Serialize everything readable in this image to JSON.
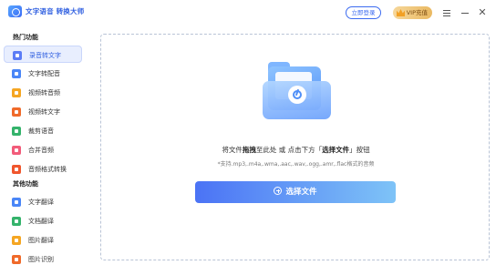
{
  "app": {
    "title": "文字语音 转换大师"
  },
  "header": {
    "login_label": "立即登录",
    "vip_label": "VIP充值",
    "icons": [
      "menu-icon",
      "minimize-icon",
      "close-icon"
    ],
    "close_glyph": "✕"
  },
  "sidebar": {
    "hot_section": "热门功能",
    "hot_items": [
      {
        "label": "录音转文字",
        "icon": "record-to-text-icon",
        "color": "#5b7cf6",
        "active": true
      },
      {
        "label": "文字转配音",
        "icon": "text-to-voice-icon",
        "color": "#4a86f7",
        "active": false
      },
      {
        "label": "视频转音频",
        "icon": "video-to-audio-icon",
        "color": "#f5a623",
        "active": false
      },
      {
        "label": "视频转文字",
        "icon": "video-to-text-icon",
        "color": "#f06a2a",
        "active": false
      },
      {
        "label": "裁剪语音",
        "icon": "crop-audio-icon",
        "color": "#34b36b",
        "active": false
      },
      {
        "label": "合并音频",
        "icon": "merge-audio-icon",
        "color": "#f25c7a",
        "active": false
      },
      {
        "label": "音频格式转换",
        "icon": "audio-convert-icon",
        "color": "#f0562d",
        "active": false
      }
    ],
    "other_section": "其他功能",
    "other_items": [
      {
        "label": "文字翻译",
        "icon": "text-translate-icon",
        "color": "#4a86f7",
        "active": false
      },
      {
        "label": "文档翻译",
        "icon": "doc-translate-icon",
        "color": "#34b36b",
        "active": false
      },
      {
        "label": "图片翻译",
        "icon": "image-translate-icon",
        "color": "#f5a623",
        "active": false
      },
      {
        "label": "图片识别",
        "icon": "image-ocr-icon",
        "color": "#f06a2a",
        "active": false
      }
    ]
  },
  "main": {
    "hint_part1": "将文件",
    "hint_bold1": "拖拽",
    "hint_part2": "至此处 或 点击下方「",
    "hint_bold2": "选择文件",
    "hint_part3": "」按钮",
    "formats": "*支持.mp3,.m4a,.wma,.aac,.wav,.ogg,.amr,.flac格式的音频",
    "select_button": "选择文件",
    "folder_icon": "audio-folder-icon"
  },
  "colors": {
    "accent": "#3c6bf0",
    "vip_gold": "#eab962",
    "button_start": "#4b73f5",
    "button_end": "#7ec3f7"
  }
}
